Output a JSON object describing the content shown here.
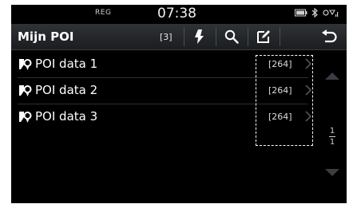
{
  "status": {
    "reg": "REG",
    "time": "07:38"
  },
  "header": {
    "title": "Mijn POI",
    "count": "[3]"
  },
  "toolbar": {
    "download_icon": "download-icon",
    "search_icon": "search-icon",
    "edit_icon": "edit-icon",
    "back_icon": "back-icon"
  },
  "list": {
    "items": [
      {
        "label": "POI data 1",
        "count": "[264]"
      },
      {
        "label": "POI data 2",
        "count": "[264]"
      },
      {
        "label": "POI data 3",
        "count": "[264]"
      }
    ]
  },
  "pager": {
    "current": "1",
    "total": "1"
  }
}
